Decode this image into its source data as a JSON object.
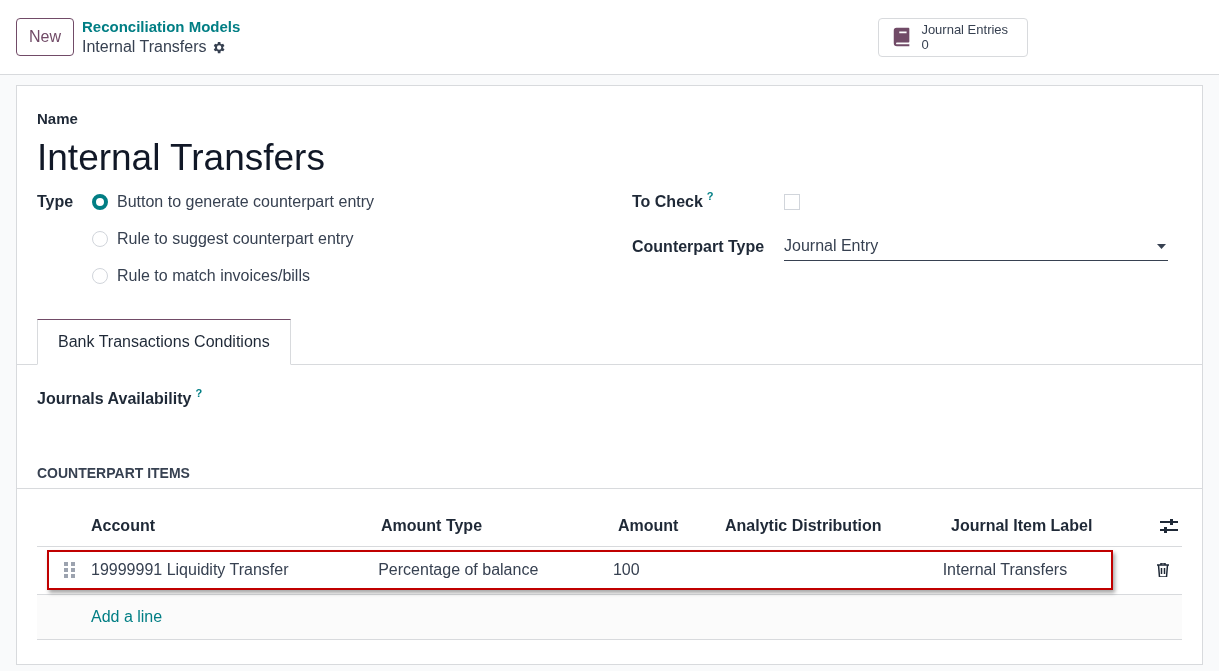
{
  "control_panel": {
    "new_button": "New",
    "breadcrumb": "Reconciliation Models",
    "record_title": "Internal Transfers",
    "smart_button": {
      "label": "Journal Entries",
      "count": "0"
    }
  },
  "form": {
    "name_label": "Name",
    "name_value": "Internal Transfers",
    "type_label": "Type",
    "type_options": [
      {
        "label": "Button to generate counterpart entry",
        "selected": true
      },
      {
        "label": "Rule to suggest counterpart entry",
        "selected": false
      },
      {
        "label": "Rule to match invoices/bills",
        "selected": false
      }
    ],
    "to_check": {
      "label": "To Check",
      "help": "?",
      "checked": false
    },
    "counterpart_type": {
      "label": "Counterpart Type",
      "value": "Journal Entry"
    }
  },
  "tabs": [
    {
      "label": "Bank Transactions Conditions",
      "selected": true
    }
  ],
  "journals_availability": {
    "label": "Journals Availability",
    "help": "?"
  },
  "counterpart_items": {
    "heading": "COUNTERPART ITEMS",
    "columns": [
      "Account",
      "Amount Type",
      "Amount",
      "Analytic Distribution",
      "Journal Item Label"
    ],
    "rows": [
      {
        "cells": [
          "19999991 Liquidity Transfer",
          "Percentage of balance",
          "100",
          "",
          "Internal Transfers"
        ],
        "highlighted": true
      }
    ],
    "add_line": "Add a line"
  }
}
